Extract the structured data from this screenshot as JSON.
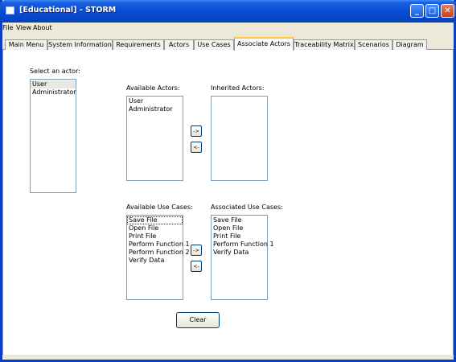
{
  "window": {
    "title": "[Educational] - STORM"
  },
  "titlebar_buttons": {
    "minimize": "_",
    "maximize": "□",
    "close": "✕"
  },
  "menu": [
    "File",
    "View",
    "About"
  ],
  "tabs": [
    {
      "label": "Main Menu",
      "active": false
    },
    {
      "label": "System Information",
      "active": false
    },
    {
      "label": "Requirements",
      "active": false
    },
    {
      "label": "Actors",
      "active": false
    },
    {
      "label": "Use Cases",
      "active": false
    },
    {
      "label": "Associate Actors",
      "active": true
    },
    {
      "label": "Traceability Matrix",
      "active": false
    },
    {
      "label": "Scenarios",
      "active": false
    },
    {
      "label": "Diagram",
      "active": false
    }
  ],
  "select_actor": {
    "label": "Select an actor:",
    "items": [
      "User",
      "Administrator"
    ],
    "selected": "User"
  },
  "available_actors": {
    "label": "Available Actors:",
    "items": [
      "User",
      "Administrator"
    ]
  },
  "inherited_actors": {
    "label": "Inherited Actors:",
    "items": []
  },
  "actor_buttons": {
    "add": "->",
    "remove": "<-"
  },
  "available_use_cases": {
    "label": "Available Use Cases:",
    "items": [
      "Save File",
      "Open File",
      "Print File",
      "Perform Function 1",
      "Perform Function 2",
      "Verify Data"
    ],
    "focused": "Save File"
  },
  "associated_use_cases": {
    "label": "Associated Use Cases:",
    "items": [
      "Save File",
      "Open File",
      "Print File",
      "Perform Function 1",
      "Verify Data"
    ]
  },
  "use_case_buttons": {
    "add": "->",
    "remove": "<-"
  },
  "clear_button": "Clear"
}
